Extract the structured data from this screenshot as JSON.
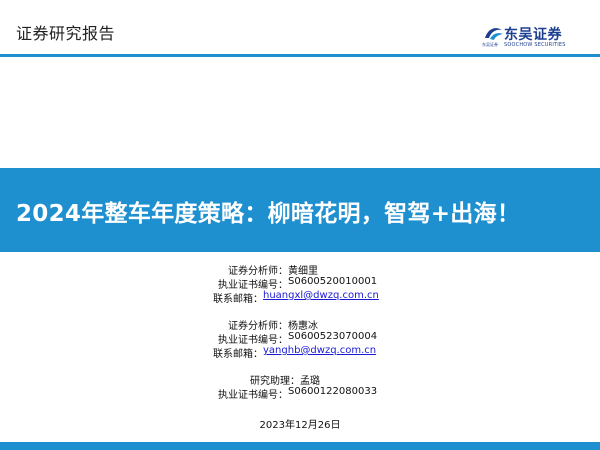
{
  "header": {
    "label": "证券研究报告",
    "logo": {
      "name_cn": "东吴证券",
      "name_en": "SOOCHOW SECURITIES",
      "sub": "东吴证券",
      "accent_color": "#1b3e8f"
    }
  },
  "title": "2024年整车年度策略：柳暗花明，智驾+出海！",
  "analysts": [
    {
      "role_label": "证券分析师：",
      "name": "黄细里",
      "cert_label": "执业证书编号：",
      "cert": "S0600520010001",
      "email_label": "联系邮箱：",
      "email": "huangxl@dwzq.com.cn"
    },
    {
      "role_label": "证券分析师：",
      "name": "杨惠冰",
      "cert_label": "执业证书编号：",
      "cert": "S0600523070004",
      "email_label": "联系邮箱：",
      "email": "yanghb@dwzq.com.cn"
    },
    {
      "role_label": "研究助理：",
      "name": "孟璐",
      "cert_label": "执业证书编号：",
      "cert": "S0600122080033"
    }
  ],
  "date": "2023年12月26日",
  "colors": {
    "brand_blue": "#1e8fcf",
    "link_blue": "#1a1ad4"
  }
}
